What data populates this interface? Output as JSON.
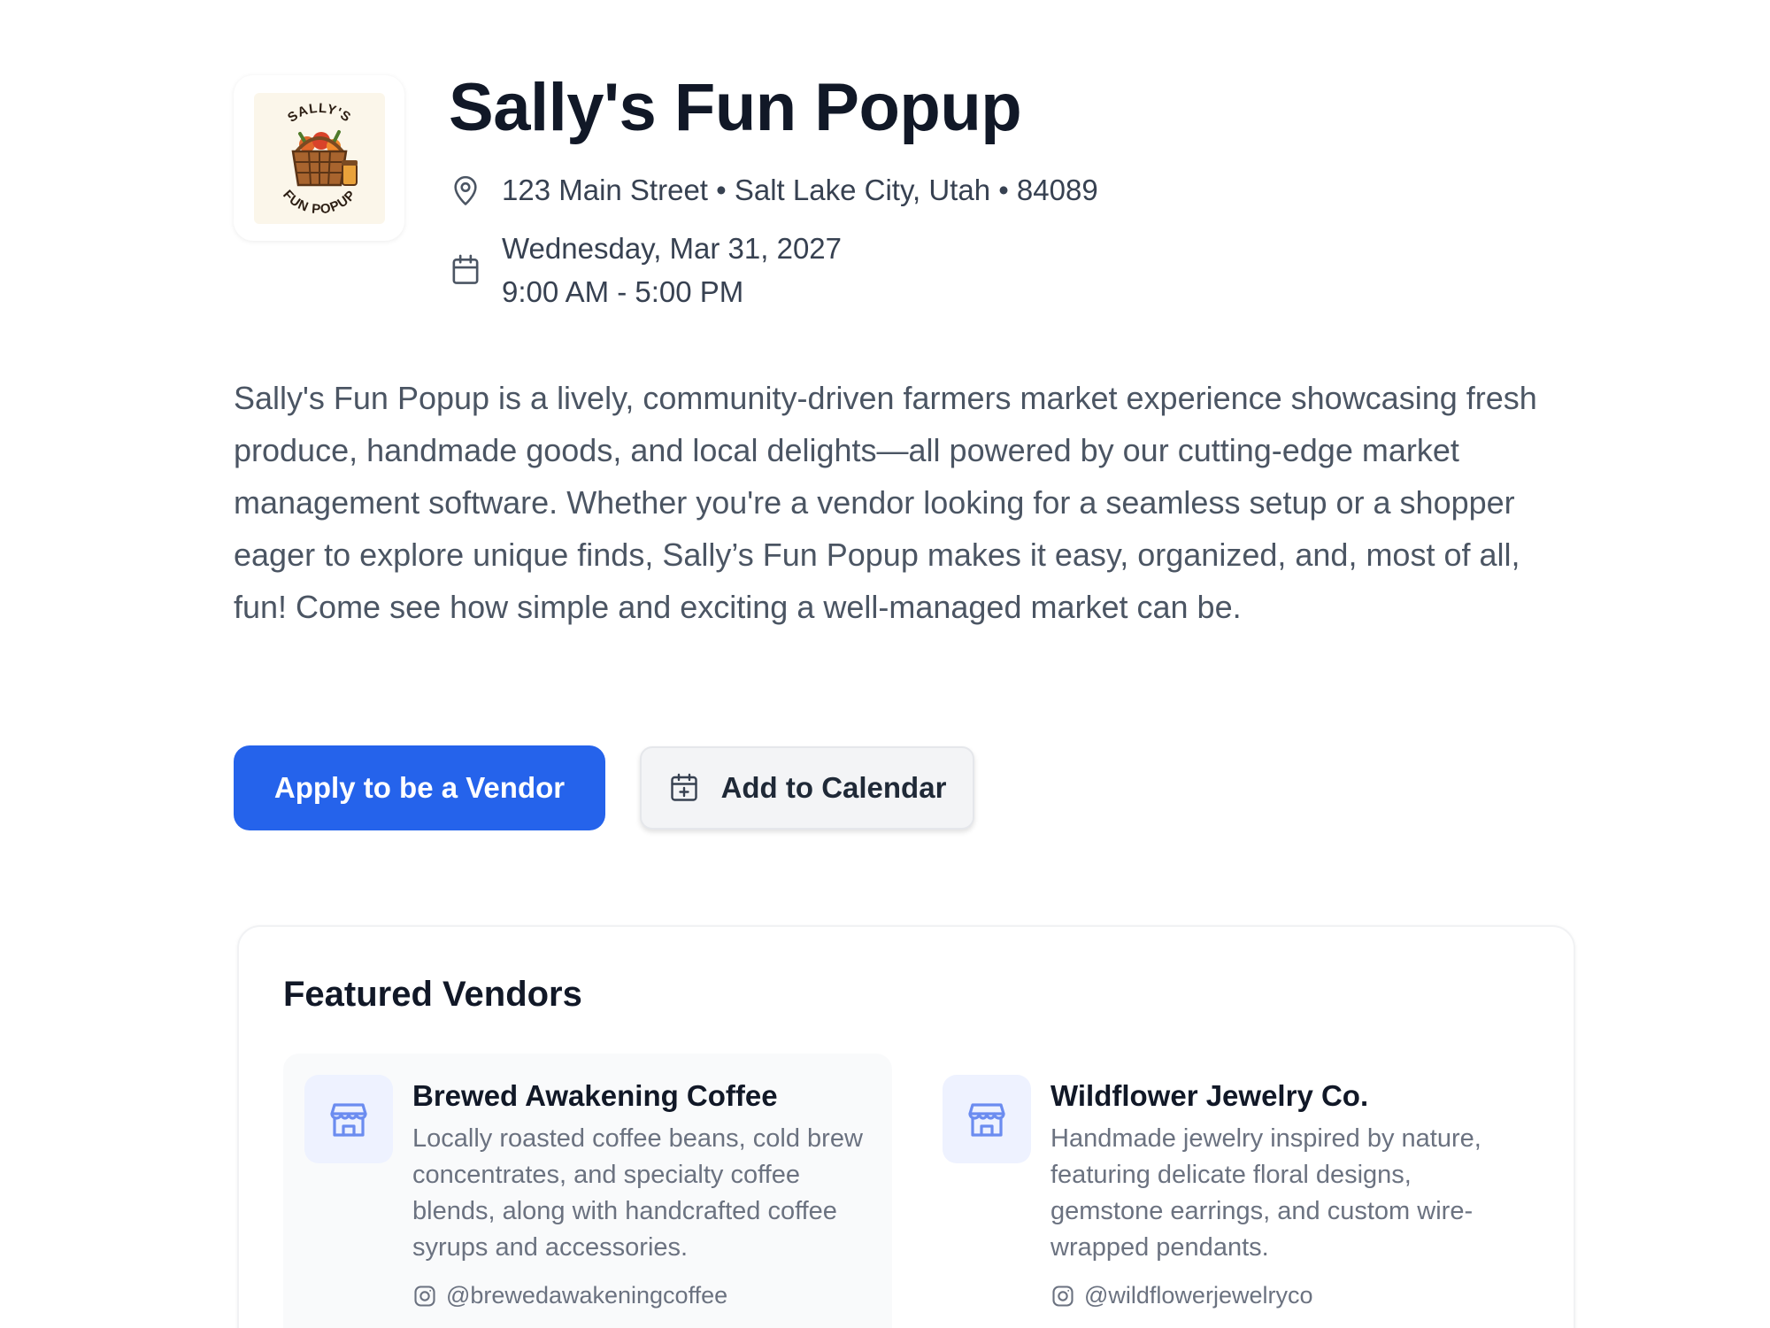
{
  "event": {
    "title": "Sally's Fun Popup",
    "address": "123 Main Street • Salt Lake City, Utah • 84089",
    "date": "Wednesday, Mar 31, 2027",
    "time": "9:00 AM - 5:00 PM",
    "description": "Sally's Fun Popup is a lively, community-driven farmers market experience showcasing fresh produce, handmade goods, and local delights—all powered by our cutting-edge market management software. Whether you're a vendor looking for a seamless setup or a shopper eager to explore unique finds, Sally’s Fun Popup makes it easy, organized, and, most of all, fun! Come see how simple and exciting a well-managed market can be."
  },
  "logo": {
    "top_text": "SALLY'S",
    "bottom_text": "FUN POPUP"
  },
  "actions": {
    "apply_label": "Apply to be a Vendor",
    "calendar_label": "Add to Calendar"
  },
  "featured": {
    "heading": "Featured Vendors",
    "vendors": [
      {
        "name": "Brewed Awakening Coffee",
        "description": "Locally roasted coffee beans, cold brew concentrates, and specialty coffee blends, along with handcrafted coffee syrups and accessories.",
        "instagram": "@brewedawakeningcoffee"
      },
      {
        "name": "Wildflower Jewelry Co.",
        "description": "Handmade jewelry inspired by nature, featuring delicate floral designs, gemstone earrings, and custom wire-wrapped pendants.",
        "instagram": "@wildflowerjewelryco"
      }
    ]
  },
  "icons": {
    "location": "map-pin-icon",
    "date": "calendar-icon",
    "calendar_button": "calendar-plus-icon",
    "vendor": "storefront-icon",
    "social": "instagram-icon"
  },
  "colors": {
    "primary": "#2563eb",
    "text_dark": "#111827",
    "text_muted": "#6b7280",
    "vendor_icon_bg": "#eef2ff",
    "vendor_icon": "#6b8cf0"
  }
}
